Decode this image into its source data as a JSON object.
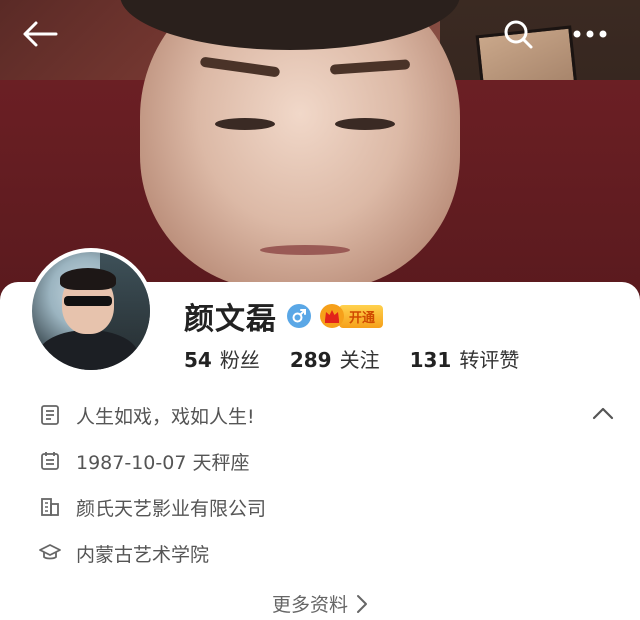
{
  "header": {
    "back_icon": "arrow-left-icon",
    "search_icon": "search-icon",
    "more_icon": "more-dots-icon"
  },
  "profile": {
    "name": "颜文磊",
    "gender_icon": "male-icon",
    "gender_color": "#5aa7e6",
    "vip_badge": "开通",
    "stats": [
      {
        "value": "54",
        "label": "粉丝"
      },
      {
        "value": "289",
        "label": "关注"
      },
      {
        "value": "131",
        "label": "转评赞"
      }
    ]
  },
  "info": {
    "bio": "人生如戏，戏如人生!",
    "birthday": "1987-10-07 天秤座",
    "company": "颜氏天艺影业有限公司",
    "school": "内蒙古艺术学院"
  },
  "more_label": "更多资料"
}
